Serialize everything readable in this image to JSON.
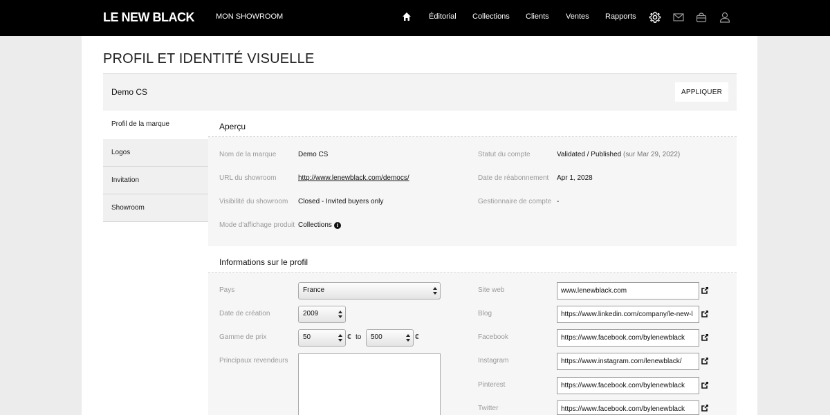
{
  "nav": {
    "logo": "LE NEW BLACK",
    "showroom": "MON SHOWROOM",
    "links": [
      "Éditorial",
      "Collections",
      "Clients",
      "Ventes",
      "Rapports"
    ]
  },
  "page": {
    "title": "PROFIL ET IDENTITÉ VISUELLE",
    "brand": "Demo CS",
    "apply": "APPLIQUER"
  },
  "menu": [
    "Profil de la marque",
    "Logos",
    "Invitation",
    "Showroom"
  ],
  "overview": {
    "title": "Aperçu",
    "brand_label": "Nom de la marque",
    "brand_value": "Demo CS",
    "url_label": "URL du showroom",
    "url_value": "http://www.lenewblack.com/democs/",
    "visibility_label": "Visibilité du showroom",
    "visibility_value": "Closed - Invited buyers only",
    "display_label": "Mode d'affichage produit",
    "display_value": "Collections",
    "status_label": "Statut du compte",
    "status_value": "Validated / Published",
    "status_note": "(sur Mar 29, 2022)",
    "renewal_label": "Date de réabonnement",
    "renewal_value": "Apr 1, 2028",
    "manager_label": "Gestionnaire de compte",
    "manager_value": "-"
  },
  "profile": {
    "title": "Informations sur le profil",
    "country_label": "Pays",
    "country_value": "France",
    "created_label": "Date de création",
    "created_value": "2009",
    "price_label": "Gamme de prix",
    "price_min": "50",
    "price_max": "500",
    "currency": "€",
    "to": "to",
    "resellers_label": "Principaux revendeurs",
    "website_label": "Site web",
    "website_value": "www.lenewblack.com",
    "blog_label": "Blog",
    "blog_value": "https://www.linkedin.com/company/le-new-l",
    "facebook_label": "Facebook",
    "facebook_value": "https://www.facebook.com/bylenewblack",
    "instagram_label": "Instagram",
    "instagram_value": "https://www.instagram.com/lenewblack/",
    "pinterest_label": "Pinterest",
    "pinterest_value": "https://www.facebook.com/bylenewblack",
    "twitter_label": "Twitter",
    "twitter_value": "https://www.facebook.com/bylenewblack"
  }
}
